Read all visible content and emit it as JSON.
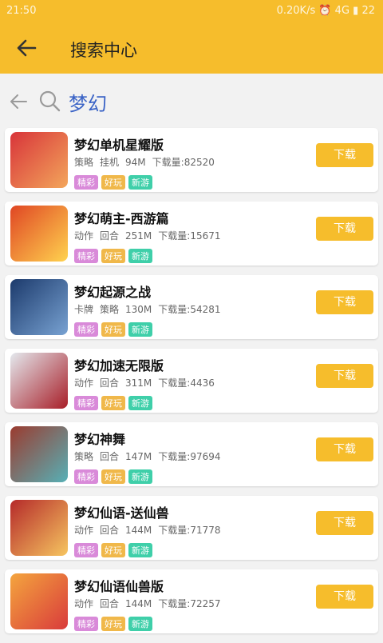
{
  "status": {
    "time": "21:50",
    "right": "0.20K/s ⏰ 4G ▮ 22"
  },
  "appbar": {
    "title": "搜索中心"
  },
  "search": {
    "query": "梦幻"
  },
  "items": [
    {
      "name": "梦幻单机星耀版",
      "type1": "策略",
      "type2": "挂机",
      "size": "94M",
      "downloads": "下载量:82520",
      "tags": [
        "精彩",
        "好玩",
        "新游"
      ],
      "button": "下载",
      "icon_colors": [
        "#d8343a",
        "#f3a65b"
      ]
    },
    {
      "name": "梦幻萌主-西游篇",
      "type1": "动作",
      "type2": "回合",
      "size": "251M",
      "downloads": "下载量:15671",
      "tags": [
        "精彩",
        "好玩",
        "新游"
      ],
      "button": "下载",
      "icon_colors": [
        "#e04624",
        "#ffd34f"
      ]
    },
    {
      "name": "梦幻起源之战",
      "type1": "卡牌",
      "type2": "策略",
      "size": "130M",
      "downloads": "下载量:54281",
      "tags": [
        "精彩",
        "好玩",
        "新游"
      ],
      "button": "下载",
      "icon_colors": [
        "#1c3a6c",
        "#78a2d2"
      ]
    },
    {
      "name": "梦幻加速无限版",
      "type1": "动作",
      "type2": "回合",
      "size": "311M",
      "downloads": "下载量:4436",
      "tags": [
        "精彩",
        "好玩",
        "新游"
      ],
      "button": "下载",
      "icon_colors": [
        "#e4e9ee",
        "#a81e28"
      ]
    },
    {
      "name": "梦幻神舞",
      "type1": "策略",
      "type2": "回合",
      "size": "147M",
      "downloads": "下载量:97694",
      "tags": [
        "精彩",
        "好玩",
        "新游"
      ],
      "button": "下载",
      "icon_colors": [
        "#9b3b2f",
        "#57b0b6"
      ]
    },
    {
      "name": "梦幻仙语-送仙兽",
      "type1": "动作",
      "type2": "回合",
      "size": "144M",
      "downloads": "下载量:71778",
      "tags": [
        "精彩",
        "好玩",
        "新游"
      ],
      "button": "下载",
      "icon_colors": [
        "#b52a2a",
        "#f6c560"
      ]
    },
    {
      "name": "梦幻仙语仙兽版",
      "type1": "动作",
      "type2": "回合",
      "size": "144M",
      "downloads": "下载量:72257",
      "tags": [
        "精彩",
        "好玩",
        "新游"
      ],
      "button": "下载",
      "icon_colors": [
        "#f4a53e",
        "#d93b3b"
      ]
    }
  ]
}
